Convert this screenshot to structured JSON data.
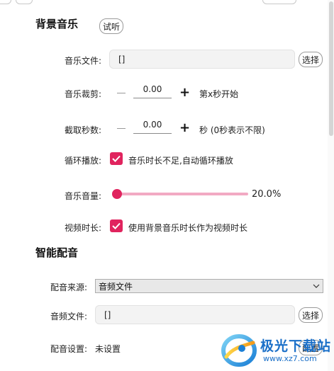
{
  "background_music": {
    "title": "背景音乐",
    "preview_button": "试听",
    "music_file": {
      "label": "音乐文件:",
      "value": "[]",
      "button": "选择"
    },
    "trim": {
      "label": "音乐裁剪:",
      "value": "0.00",
      "suffix": "第x秒开始"
    },
    "cut_seconds": {
      "label": "截取秒数:",
      "value": "0.00",
      "suffix": "秒 (0秒表示不限)"
    },
    "loop": {
      "label": "循环播放:",
      "checked": true,
      "text": "音乐时长不足,自动循环播放"
    },
    "volume": {
      "label": "音乐音量:",
      "value_text": "20.0%",
      "level": 0.0
    },
    "video_duration": {
      "label": "视频时长:",
      "checked": true,
      "text": "使用背景音乐时长作为视频时长"
    }
  },
  "smart_dubbing": {
    "title": "智能配音",
    "source": {
      "label": "配音来源:",
      "selected": "音频文件"
    },
    "audio_file": {
      "label": "音频文件:",
      "value": "[]",
      "button": "选择"
    },
    "settings": {
      "label": "配音设置:",
      "value": "未设置",
      "button": "配置"
    }
  },
  "watermark": {
    "text": "极光下载站",
    "url": "www.xz7.com"
  },
  "colors": {
    "accent": "#e0245e",
    "track": "#f2a9c3"
  }
}
